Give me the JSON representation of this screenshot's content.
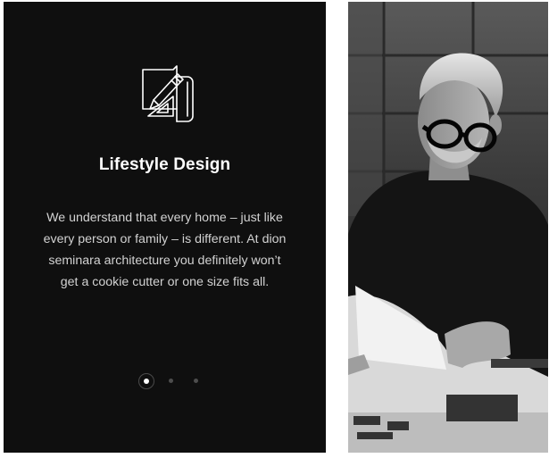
{
  "slide": {
    "icon": "blueprint-pencil-icon",
    "title": "Lifestyle Design",
    "lines": [
      "We understand that every home – just like",
      "every person or family – is different. At dion",
      "seminara architecture you definitely won’t",
      "get a cookie cutter or one size fits all."
    ]
  },
  "pagination": {
    "total": 3,
    "active": 1
  },
  "photo": {
    "icon": "architect-photo"
  },
  "colors": {
    "panel": "#0f0f0f",
    "title": "#ffffff",
    "text": "#d2d2d2"
  }
}
